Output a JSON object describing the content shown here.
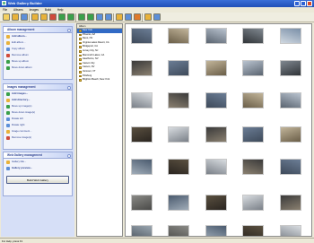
{
  "app": {
    "title": "Web Gallery Builder"
  },
  "menu": [
    "File",
    "Albums",
    "Images",
    "Build",
    "Help"
  ],
  "toolbar_icons": [
    "new-project-icon",
    "open-icon",
    "save-icon",
    "add-album-icon",
    "edit-album-icon",
    "remove-album-icon",
    "album-up-icon",
    "album-down-icon",
    "add-image-icon",
    "move-image-icon",
    "rotate-left-icon",
    "rotate-right-icon",
    "image-properties-icon",
    "preview-icon",
    "build-icon",
    "settings-icon",
    "help-icon"
  ],
  "album_panel": {
    "title": "Album management",
    "tasks": [
      {
        "label": "Add album...",
        "icon": "add-album-icon",
        "bold": true,
        "color": "#e8b23a"
      },
      {
        "label": "Edit album...",
        "icon": "edit-album-icon",
        "bold": false,
        "color": "#e8b23a"
      },
      {
        "label": "Copy album",
        "icon": "copy-album-icon",
        "bold": false,
        "color": "#5d8fd8"
      },
      {
        "label": "Remove album",
        "icon": "remove-album-icon",
        "bold": false,
        "color": "#d04a3a"
      },
      {
        "label": "Move up album",
        "icon": "move-up-icon",
        "bold": false,
        "color": "#3aa04a"
      },
      {
        "label": "Move down album",
        "icon": "move-down-icon",
        "bold": false,
        "color": "#3aa04a"
      }
    ]
  },
  "image_panel": {
    "title": "Images management",
    "tasks": [
      {
        "label": "Add images...",
        "icon": "add-images-icon",
        "bold": true,
        "color": "#3aa04a"
      },
      {
        "label": "Add directory...",
        "icon": "add-directory-icon",
        "bold": true,
        "color": "#e8b23a"
      },
      {
        "label": "Move up image(s)",
        "icon": "move-up-image-icon",
        "bold": false,
        "color": "#3aa04a"
      },
      {
        "label": "Move down image(s)",
        "icon": "move-down-image-icon",
        "bold": false,
        "color": "#3aa04a"
      },
      {
        "label": "Rotate left",
        "icon": "rotate-left-icon",
        "bold": false,
        "color": "#5d8fd8"
      },
      {
        "label": "Rotate right",
        "icon": "rotate-right-icon",
        "bold": false,
        "color": "#5d8fd8"
      },
      {
        "label": "Image comment...",
        "icon": "image-comment-icon",
        "bold": false,
        "color": "#e8b23a"
      },
      {
        "label": "Remove image(s)",
        "icon": "remove-image-icon",
        "bold": false,
        "color": "#d04a3a"
      }
    ]
  },
  "gallery_panel": {
    "title": "Web Gallery management",
    "tasks": [
      {
        "label": "Gallery title...",
        "icon": "gallery-title-icon",
        "bold": false,
        "color": "#e8b23a"
      },
      {
        "label": "Gallery preview...",
        "icon": "gallery-preview-icon",
        "bold": true,
        "color": "#5d8fd8"
      }
    ],
    "build_label": "Build Web Gallery"
  },
  "albums_list": {
    "header": "Album",
    "items": [
      "New York",
      "Phoenix, AZ",
      "Reno, NV",
      "Virginia Lakes Resort, CA",
      "Bridgeport, CA",
      "Jersey City, NJ",
      "Mammoth Lakes, CA",
      "Hawthorne, NV",
      "Carson City",
      "Carson, NV",
      "Vermont, VT",
      "Pittsburg",
      "Brighton Beach, New York"
    ],
    "selected_index": 0
  },
  "status": {
    "text": "For Help, press F1"
  }
}
